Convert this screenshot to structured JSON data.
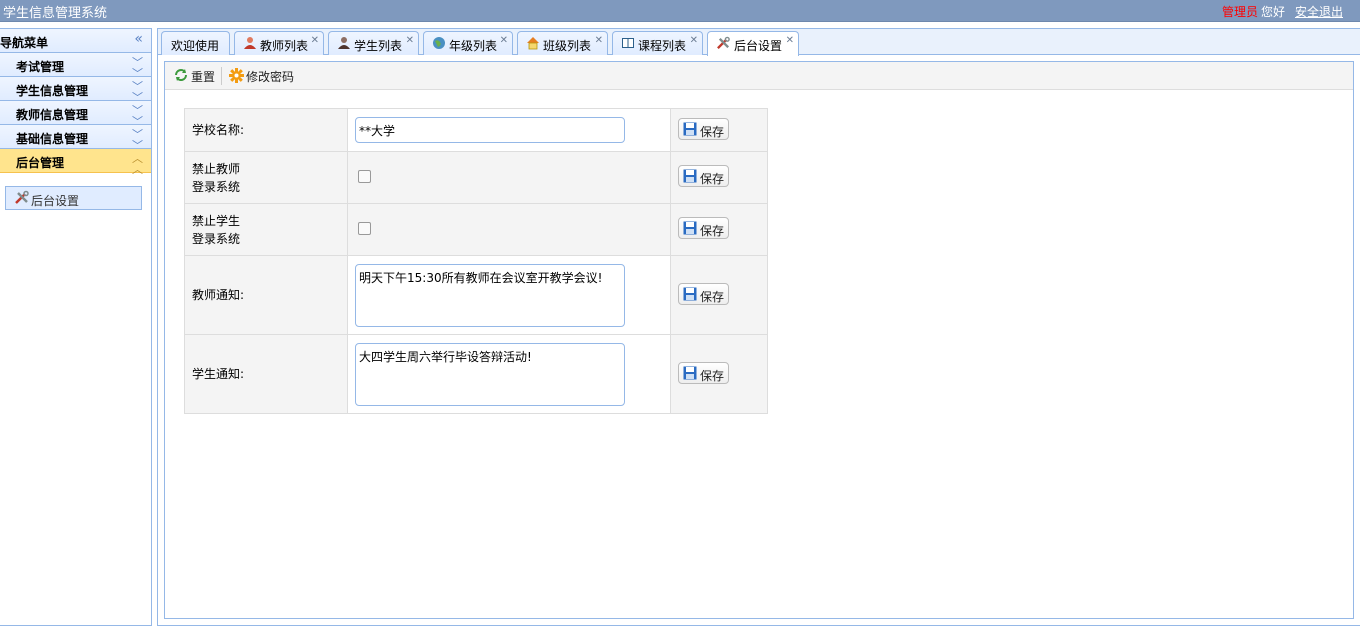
{
  "header": {
    "title": "学生信息管理系统",
    "role": "管理员",
    "greeting": "您好",
    "logout": "安全退出"
  },
  "sidebar": {
    "title": "导航菜单",
    "sections": [
      {
        "label": "考试管理"
      },
      {
        "label": "学生信息管理"
      },
      {
        "label": "教师信息管理"
      },
      {
        "label": "基础信息管理"
      },
      {
        "label": "后台管理"
      }
    ],
    "active_item": "后台设置"
  },
  "tabs": [
    {
      "label": "欢迎使用"
    },
    {
      "label": "教师列表"
    },
    {
      "label": "学生列表"
    },
    {
      "label": "年级列表"
    },
    {
      "label": "班级列表"
    },
    {
      "label": "课程列表"
    },
    {
      "label": "后台设置"
    }
  ],
  "toolbar": {
    "reset": "重置",
    "change_password": "修改密码"
  },
  "form": {
    "school_name_label": "学校名称:",
    "school_name_value": "**大学",
    "forbid_teacher_label_1": "禁止教师",
    "forbid_teacher_label_2": "登录系统",
    "forbid_student_label_1": "禁止学生",
    "forbid_student_label_2": "登录系统",
    "teacher_notice_label": "教师通知:",
    "teacher_notice_value": "明天下午15:30所有教师在会议室开教学会议!",
    "student_notice_label": "学生通知:",
    "student_notice_value": "大四学生周六举行毕设答辩活动!",
    "save_label": "保存"
  },
  "colors": {
    "header_bg": "#7f99be",
    "role_text": "#ff0000",
    "border": "#95b8e7",
    "active_section": "#ffe48d"
  }
}
